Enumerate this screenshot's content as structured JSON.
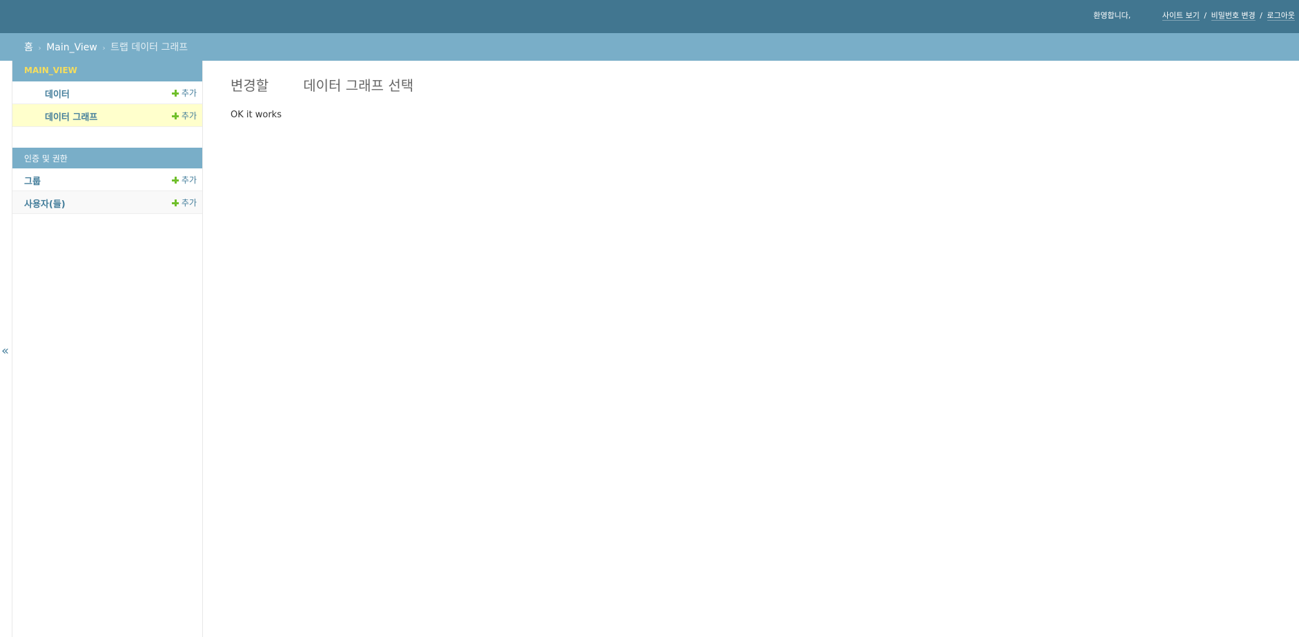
{
  "header": {
    "welcome": "환영합니다,",
    "links": {
      "view_site": "사이트 보기",
      "change_password": "비밀번호 변경",
      "logout": "로그아웃",
      "separator": "/"
    }
  },
  "breadcrumbs": {
    "home": "홈",
    "app": "Main_View",
    "current": "트랩 데이터 그래프",
    "separator": "›"
  },
  "sidebar": {
    "modules": [
      {
        "caption": "MAIN_VIEW",
        "rows": [
          {
            "label": "데이터",
            "add": "추가"
          },
          {
            "label": "데이터 그래프",
            "add": "추가"
          }
        ]
      },
      {
        "caption": "인증 및 권한",
        "rows": [
          {
            "label": "그룹",
            "add": "추가"
          },
          {
            "label": "사용자(들)",
            "add": "추가"
          }
        ]
      }
    ],
    "toggle": "«"
  },
  "content": {
    "title_part1": "변경할",
    "title_part2": "데이터 그래프 선택",
    "body": "OK it works"
  },
  "colors": {
    "header_bg": "#417690",
    "breadcrumb_bg": "#79aec8",
    "caption_bg": "#79aec8",
    "app_caption_text": "#f5dd5d",
    "link": "#447e9b",
    "selected_row": "#ffffcc",
    "add_icon": "#70bf2b"
  }
}
